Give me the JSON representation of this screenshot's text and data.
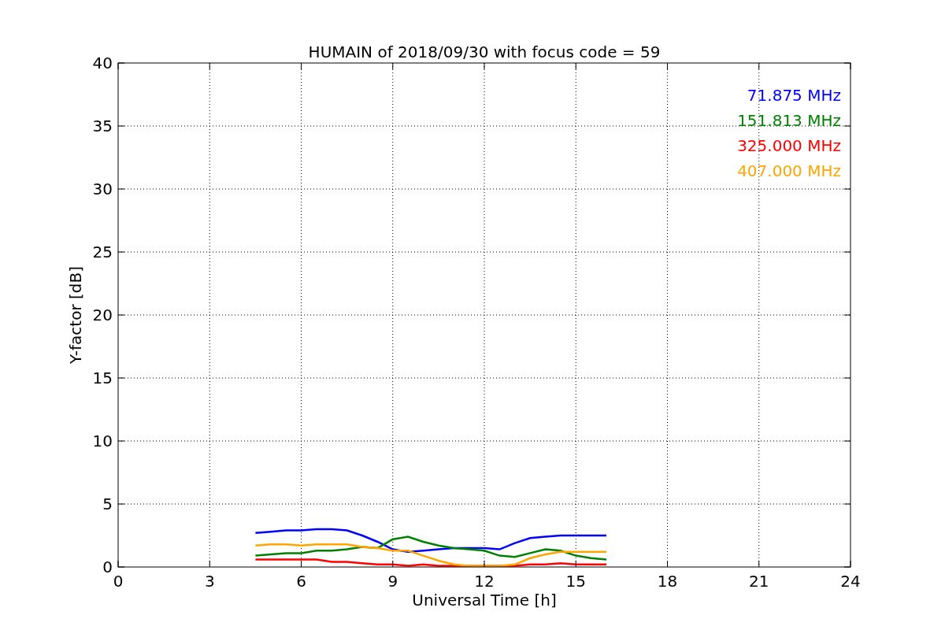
{
  "chart_data": {
    "type": "line",
    "title": "HUMAIN of 2018/09/30 with focus code = 59",
    "xlabel": "Universal Time [h]",
    "ylabel": "Y-factor [dB]",
    "x": [
      4.5,
      5,
      5.5,
      6,
      6.5,
      7,
      7.5,
      8,
      8.5,
      9,
      9.5,
      10,
      10.5,
      11,
      11.5,
      12,
      12.5,
      13,
      13.5,
      14,
      14.5,
      15,
      15.5,
      16
    ],
    "series": [
      {
        "name": "71.875 MHz",
        "color": "#0000ff",
        "values": [
          2.7,
          2.8,
          2.9,
          2.9,
          3.0,
          3.0,
          2.9,
          2.5,
          2.0,
          1.4,
          1.2,
          1.3,
          1.4,
          1.5,
          1.5,
          1.5,
          1.4,
          1.9,
          2.3,
          2.4,
          2.5,
          2.5,
          2.5,
          2.5
        ]
      },
      {
        "name": "151.813 MHz",
        "color": "#008000",
        "values": [
          0.9,
          1.0,
          1.1,
          1.1,
          1.3,
          1.3,
          1.4,
          1.6,
          1.5,
          2.2,
          2.4,
          2.0,
          1.7,
          1.5,
          1.4,
          1.3,
          0.9,
          0.8,
          1.1,
          1.4,
          1.3,
          0.9,
          0.7,
          0.6
        ]
      },
      {
        "name": "325.000 MHz",
        "color": "#ff0000",
        "values": [
          0.6,
          0.6,
          0.6,
          0.6,
          0.6,
          0.4,
          0.4,
          0.3,
          0.2,
          0.2,
          0.1,
          0.2,
          0.1,
          0.1,
          0.1,
          0.1,
          0.1,
          0.1,
          0.2,
          0.2,
          0.3,
          0.2,
          0.2,
          0.2
        ]
      },
      {
        "name": "407.000 MHz",
        "color": "#ffa500",
        "values": [
          1.7,
          1.8,
          1.8,
          1.7,
          1.8,
          1.8,
          1.8,
          1.6,
          1.5,
          1.3,
          1.3,
          0.9,
          0.5,
          0.2,
          0.1,
          0.1,
          0.1,
          0.2,
          0.7,
          1.0,
          1.2,
          1.2,
          1.2,
          1.2
        ]
      }
    ],
    "xlim": [
      0,
      24
    ],
    "ylim": [
      0,
      40
    ],
    "xticks": [
      0,
      3,
      6,
      9,
      12,
      15,
      18,
      21,
      24
    ],
    "yticks": [
      0,
      5,
      10,
      15,
      20,
      25,
      30,
      35,
      40
    ],
    "grid": true
  }
}
